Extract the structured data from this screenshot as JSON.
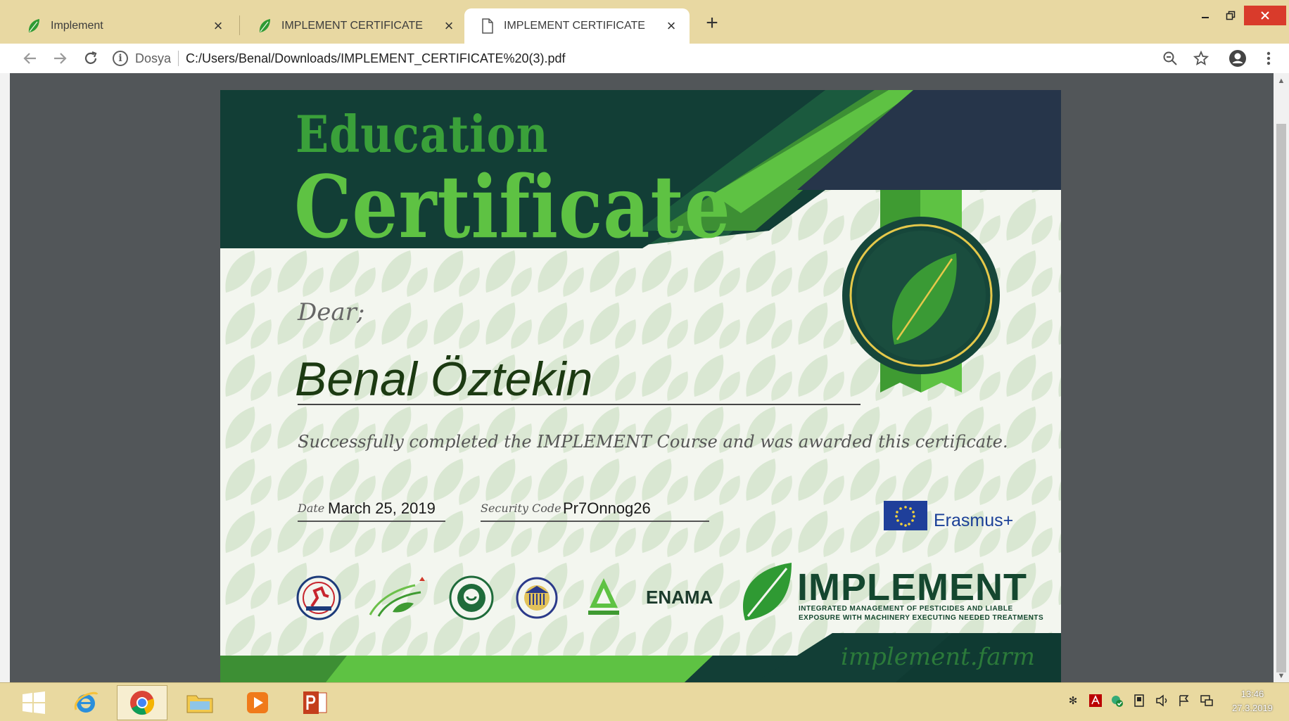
{
  "browser": {
    "tabs": [
      {
        "title": "Implement",
        "icon": "leaf-icon",
        "active": false
      },
      {
        "title": "IMPLEMENT CERTIFICATE",
        "icon": "leaf-icon",
        "active": false
      },
      {
        "title": "IMPLEMENT CERTIFICATE",
        "icon": "document-icon",
        "active": true
      }
    ],
    "new_tab_label": "+",
    "address": {
      "scheme_label": "Dosya",
      "url": "C:/Users/Benal/Downloads/IMPLEMENT_CERTIFICATE%20(3).pdf"
    }
  },
  "certificate": {
    "heading_line1": "Education",
    "heading_line2": "Certificate",
    "salutation": "Dear;",
    "recipient": "Benal Öztekin",
    "statement": "Successfully completed the IMPLEMENT Course and was awarded this certificate.",
    "date_label": "Date",
    "date_value": "March 25, 2019",
    "security_label": "Security Code",
    "security_value": "Pr7Onnog26",
    "program": "Erasmus+",
    "brand": "IMPLEMENT",
    "tagline_line1": "INTEGRATED MANAGEMENT OF PESTICIDES AND LIABLE",
    "tagline_line2": "EXPOSURE WITH MACHINERY EXECUTING NEEDED TREATMENTS",
    "website": "implement.farm",
    "partners": [
      "ENAMA"
    ]
  },
  "colors": {
    "dark_green": "#123e36",
    "bright_green": "#5ec243",
    "mid_green": "#3aa03a",
    "navy": "#26354a",
    "erasmus_blue": "#1a3f97"
  },
  "taskbar": {
    "apps": [
      "windows-start-icon",
      "internet-explorer-icon",
      "chrome-icon",
      "file-explorer-icon",
      "media-player-icon",
      "powerpoint-icon"
    ],
    "clock_time": "13:46",
    "clock_date": "27.3.2019"
  }
}
